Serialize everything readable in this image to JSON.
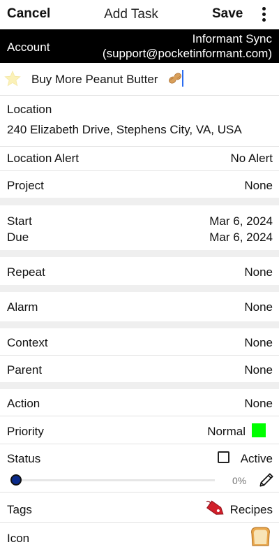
{
  "header": {
    "cancel_label": "Cancel",
    "title": "Add Task",
    "save_label": "Save",
    "menu_icon": "more-vertical-icon"
  },
  "account": {
    "label": "Account",
    "name": "Informant Sync",
    "email": "(support@pocketinformant.com)"
  },
  "task": {
    "star_icon": "star-icon",
    "name": "Buy More Peanut Butter",
    "emoji_icon": "peanut-icon"
  },
  "location": {
    "label": "Location",
    "address": "240 Elizabeth Drive, Stephens City, VA, USA"
  },
  "location_alert": {
    "label": "Location Alert",
    "value": "No Alert"
  },
  "project": {
    "label": "Project",
    "value": "None"
  },
  "dates": {
    "start_label": "Start",
    "start_value": "Mar 6, 2024",
    "due_label": "Due",
    "due_value": "Mar 6, 2024"
  },
  "repeat": {
    "label": "Repeat",
    "value": "None"
  },
  "alarm": {
    "label": "Alarm",
    "value": "None"
  },
  "context": {
    "label": "Context",
    "value": "None"
  },
  "parent": {
    "label": "Parent",
    "value": "None"
  },
  "action": {
    "label": "Action",
    "value": "None"
  },
  "priority": {
    "label": "Priority",
    "value": "Normal",
    "color": "#00ff00"
  },
  "status": {
    "label": "Status",
    "checkbox_label": "Active",
    "checked": false,
    "progress_fraction": 0.0,
    "progress_text": "0%",
    "edit_icon": "pencil-icon"
  },
  "tags": {
    "label": "Tags",
    "value": "Recipes",
    "icon": "tag-icon",
    "icon_color": "#d11f2a"
  },
  "icon": {
    "label": "Icon",
    "icon": "bread-icon"
  }
}
